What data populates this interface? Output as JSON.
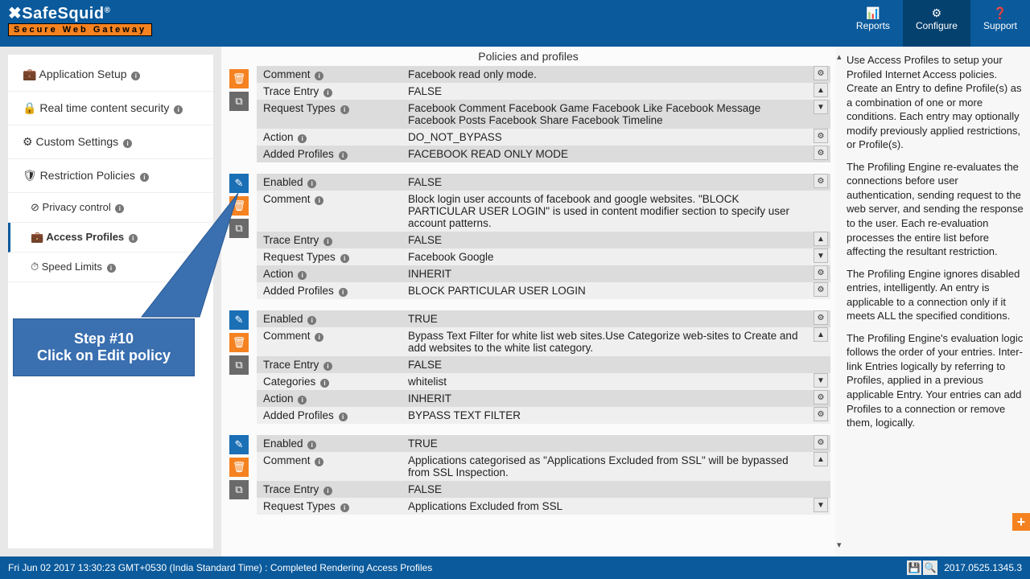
{
  "brand": {
    "name": "SafeSquid",
    "reg": "®",
    "tagline": "Secure Web Gateway"
  },
  "nav": {
    "reports": "Reports",
    "configure": "Configure",
    "support": "Support"
  },
  "sidebar": {
    "items": [
      {
        "label": "Application Setup",
        "icon": "💼"
      },
      {
        "label": "Real time content security",
        "icon": "🔒"
      },
      {
        "label": "Custom Settings",
        "icon": "⚙"
      },
      {
        "label": "Restriction Policies",
        "icon": "🛡"
      }
    ],
    "subitems": [
      {
        "label": "Privacy control",
        "icon": "⊘"
      },
      {
        "label": "Access Profiles",
        "icon": "💼"
      },
      {
        "label": "Speed Limits",
        "icon": "⏱"
      }
    ]
  },
  "page_title": "Policies and profiles",
  "labels": {
    "enabled": "Enabled",
    "comment": "Comment",
    "trace": "Trace Entry",
    "reqtypes": "Request Types",
    "action": "Action",
    "added": "Added Profiles",
    "categories": "Categories"
  },
  "policies": [
    {
      "partial_top": true,
      "rows": [
        {
          "k": "comment",
          "v": "Facebook read only mode."
        },
        {
          "k": "trace",
          "v": "FALSE"
        },
        {
          "k": "reqtypes",
          "v": "Facebook Comment   Facebook Game   Facebook Like   Facebook Message   Facebook Posts   Facebook Share   Facebook Timeline"
        },
        {
          "k": "action",
          "v": "DO_NOT_BYPASS"
        },
        {
          "k": "added",
          "v": "FACEBOOK READ ONLY MODE"
        }
      ],
      "side": [
        "gear",
        "up",
        "down",
        "gear",
        "gear"
      ]
    },
    {
      "rows": [
        {
          "k": "enabled",
          "v": "FALSE"
        },
        {
          "k": "comment",
          "v": "Block login user accounts of facebook and google websites. \"BLOCK PARTICULAR USER LOGIN\" is used in content modifier section to specify user account patterns."
        },
        {
          "k": "trace",
          "v": "FALSE"
        },
        {
          "k": "reqtypes",
          "v": "Facebook   Google"
        },
        {
          "k": "action",
          "v": "INHERIT"
        },
        {
          "k": "added",
          "v": "BLOCK PARTICULAR USER LOGIN"
        }
      ],
      "side": [
        "gear",
        "",
        "up",
        "down",
        "gear",
        "gear"
      ]
    },
    {
      "rows": [
        {
          "k": "enabled",
          "v": "TRUE"
        },
        {
          "k": "comment",
          "v": "Bypass Text Filter for white list web sites.Use Categorize web-sites to Create and add websites to the white list category."
        },
        {
          "k": "trace",
          "v": "FALSE"
        },
        {
          "k": "categories",
          "v": "whitelist"
        },
        {
          "k": "action",
          "v": "INHERIT"
        },
        {
          "k": "added",
          "v": "BYPASS TEXT FILTER"
        }
      ],
      "side": [
        "gear",
        "up",
        "",
        "down",
        "gear",
        "gear"
      ]
    },
    {
      "rows": [
        {
          "k": "enabled",
          "v": "TRUE"
        },
        {
          "k": "comment",
          "v": "Applications categorised as \"Applications Excluded from SSL\" will be bypassed from SSL Inspection."
        },
        {
          "k": "trace",
          "v": "FALSE"
        },
        {
          "k": "reqtypes",
          "v": "Applications Excluded from SSL"
        }
      ],
      "side": [
        "gear",
        "up",
        "",
        "down"
      ]
    }
  ],
  "help": {
    "p1": "Use Access Profiles to setup your Profiled Internet Access policies. Create an Entry to define Profile(s) as a combination of one or more conditions. Each entry may optionally modify previously applied restrictions, or Profile(s).",
    "p2": "The Profiling Engine re-evaluates the connections before user authentication, sending request to the web server, and sending the response to the user. Each re-evaluation processes the entire list before affecting the resultant restriction.",
    "p3": "The Profiling Engine ignores disabled entries, intelligently. An entry is applicable to a connection only if it meets ALL the specified conditions.",
    "p4": "The Profiling Engine's evaluation logic follows the order of your entries. Inter-link Entries logically by referring to Profiles, applied in a previous applicable Entry. Your entries can add Profiles to a connection or remove them, logically."
  },
  "callout": {
    "line1": "Step #10",
    "line2": "Click on Edit policy"
  },
  "footer": {
    "status": "Fri Jun 02 2017 13:30:23 GMT+0530 (India Standard Time) : Completed Rendering Access Profiles",
    "version": "2017.0525.1345.3"
  }
}
